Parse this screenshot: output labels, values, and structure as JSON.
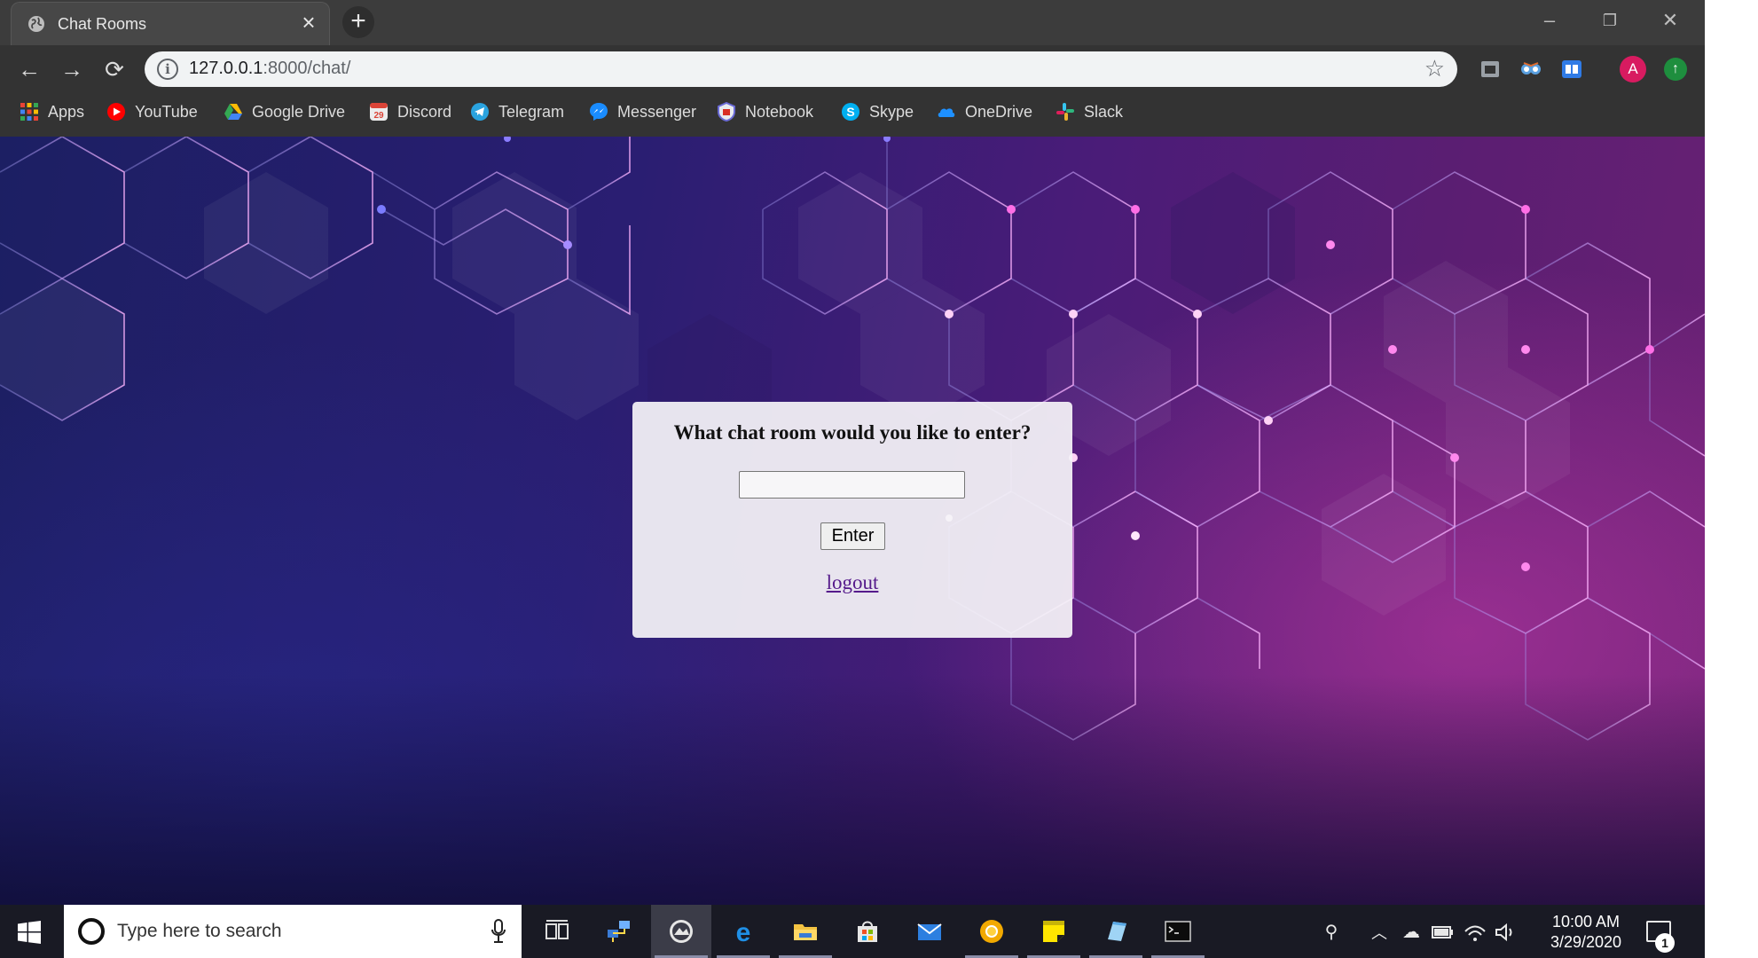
{
  "browser": {
    "tab": {
      "title": "Chat Rooms"
    },
    "address": {
      "host": "127.0.0.1",
      "rest": ":8000/chat/"
    },
    "profile_initial": "A",
    "bookmarks": [
      {
        "label": "Apps",
        "icon": "apps-grid-icon"
      },
      {
        "label": "YouTube",
        "icon": "youtube-icon"
      },
      {
        "label": "Google Drive",
        "icon": "google-drive-icon"
      },
      {
        "label": "Discord",
        "icon": "discord-icon"
      },
      {
        "label": "Telegram",
        "icon": "telegram-icon"
      },
      {
        "label": "Messenger",
        "icon": "messenger-icon"
      },
      {
        "label": "Notebook",
        "icon": "notebook-icon"
      },
      {
        "label": "Skype",
        "icon": "skype-icon"
      },
      {
        "label": "OneDrive",
        "icon": "onedrive-icon"
      },
      {
        "label": "Slack",
        "icon": "slack-icon"
      }
    ]
  },
  "page": {
    "question": "What chat room would you like to enter?",
    "room_input_value": "",
    "enter_label": "Enter",
    "logout_label": "logout"
  },
  "taskbar": {
    "search_placeholder": "Type here to search",
    "clock_time": "10:00 AM",
    "clock_date": "3/29/2020",
    "notification_count": "1"
  },
  "colors": {
    "accent_purple": "#6a2174",
    "accent_blue": "#1c1f63",
    "link": "#551a8b",
    "avatar": "#d81b60"
  }
}
